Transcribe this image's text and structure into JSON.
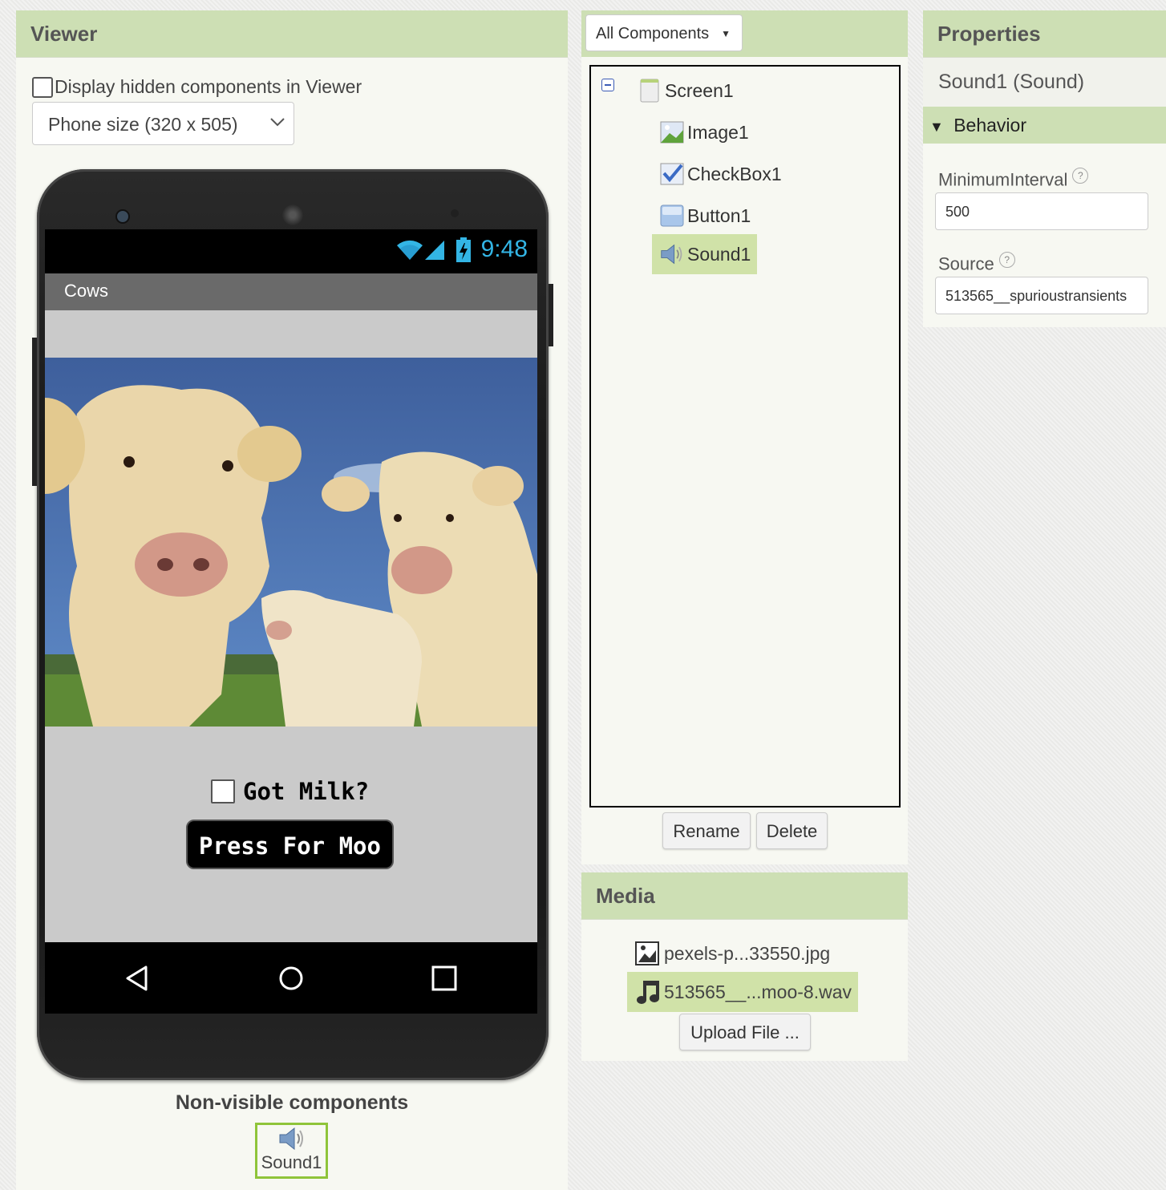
{
  "viewer": {
    "title": "Viewer",
    "hidden_components_label": "Display hidden components in Viewer",
    "phone_size_selected": "Phone size (320 x 505)",
    "phone": {
      "status_time": "9:48",
      "app_title": "Cows",
      "checkbox_label": "Got Milk?",
      "button_label": "Press For Moo"
    },
    "nonvisible_title": "Non-visible components",
    "nonvisible_items": [
      {
        "label": "Sound1",
        "icon": "speaker-icon"
      }
    ]
  },
  "components": {
    "dropdown_label": "All Components",
    "tree": [
      {
        "label": "Screen1",
        "icon": "screen-icon",
        "collapse": "minus-icon"
      },
      {
        "label": "Image1",
        "icon": "image-icon"
      },
      {
        "label": "CheckBox1",
        "icon": "checkbox-icon"
      },
      {
        "label": "Button1",
        "icon": "button-icon"
      },
      {
        "label": "Sound1",
        "icon": "speaker-icon",
        "selected": true
      }
    ],
    "rename_label": "Rename",
    "delete_label": "Delete"
  },
  "media": {
    "title": "Media",
    "items": [
      {
        "label": "pexels-p...33550.jpg",
        "icon": "picture-file-icon"
      },
      {
        "label": "513565__...moo-8.wav",
        "icon": "music-file-icon",
        "selected": true
      }
    ],
    "upload_label": "Upload File ..."
  },
  "properties": {
    "title": "Properties",
    "component_name": "Sound1 (Sound)",
    "section": "Behavior",
    "fields": [
      {
        "label": "MinimumInterval",
        "value": "500"
      },
      {
        "label": "Source",
        "value": "513565__spurioustransients"
      }
    ]
  },
  "colors": {
    "header_green": "#cddfb4",
    "selection_green": "#d0e2a8",
    "status_blue": "#33b5e5"
  }
}
